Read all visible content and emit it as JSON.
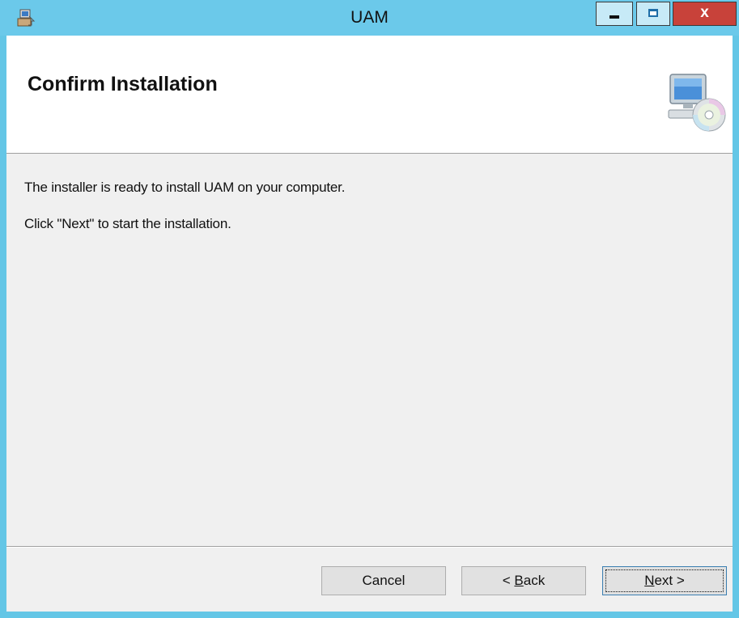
{
  "window": {
    "title": "UAM",
    "close_glyph": "x",
    "controls": [
      "minimize",
      "maximize",
      "close"
    ]
  },
  "header": {
    "title": "Confirm Installation",
    "icon": "computer-with-cd-icon"
  },
  "body": {
    "line1": "The installer is ready to install UAM on your computer.",
    "line2": "Click \"Next\" to start the installation."
  },
  "buttons": {
    "cancel": "Cancel",
    "back_prefix": "< ",
    "back_accel": "B",
    "back_rest": "ack",
    "next_accel": "N",
    "next_rest": "ext >"
  },
  "colors": {
    "titlebar": "#6bc9ea",
    "close_button": "#c8423a",
    "client_bg": "#f0f0f0",
    "banner_bg": "#ffffff"
  }
}
